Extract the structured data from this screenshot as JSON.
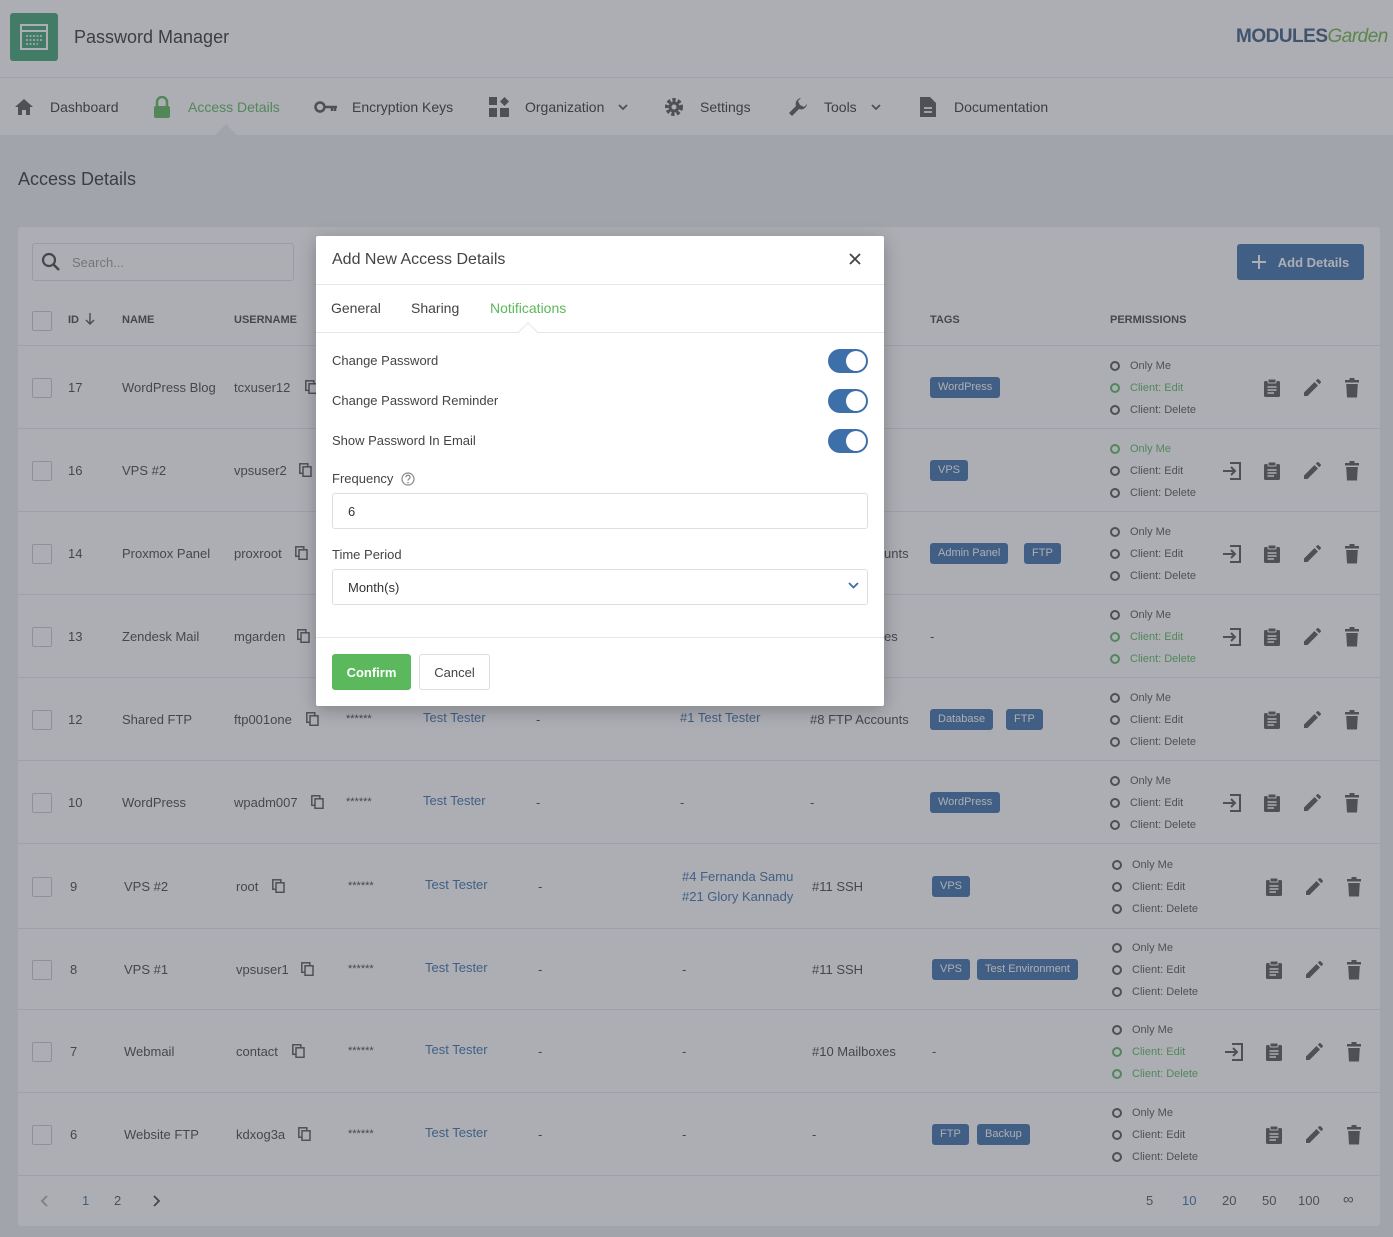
{
  "app": {
    "title": "Password Manager",
    "brand_main": "MODULES",
    "brand_accent": "Garden"
  },
  "nav": [
    {
      "label": "Dashboard",
      "icon": "home-icon"
    },
    {
      "label": "Access Details",
      "icon": "lock-icon",
      "active": true
    },
    {
      "label": "Encryption Keys",
      "icon": "key-icon"
    },
    {
      "label": "Organization",
      "icon": "grid-icon",
      "dropdown": true
    },
    {
      "label": "Settings",
      "icon": "gear-icon"
    },
    {
      "label": "Tools",
      "icon": "wrench-icon",
      "dropdown": true
    },
    {
      "label": "Documentation",
      "icon": "document-icon"
    }
  ],
  "page": {
    "title": "Access Details",
    "search_placeholder": "Search...",
    "add_button": "Add Details"
  },
  "table": {
    "headers": {
      "id": "ID",
      "name": "NAME",
      "username": "USERNAME",
      "tags": "TAGS",
      "permissions": "PERMISSIONS"
    },
    "rows": [
      {
        "id": "17",
        "name": "WordPress Blog",
        "username": "tcxuser12",
        "tags": [
          "WordPress"
        ],
        "perms": [
          "Only Me",
          "Client: Edit",
          "Client: Delete"
        ],
        "perm_on": [
          false,
          true,
          false
        ],
        "login": false
      },
      {
        "id": "16",
        "name": "VPS #2",
        "username": "vpsuser2",
        "tags": [
          "VPS"
        ],
        "perms": [
          "Only Me",
          "Client: Edit",
          "Client: Delete"
        ],
        "perm_on": [
          true,
          false,
          false
        ],
        "login": true
      },
      {
        "id": "14",
        "name": "Proxmox Panel",
        "username": "proxroot",
        "group_tail": "unts",
        "tags": [
          "Admin Panel",
          "FTP"
        ],
        "perms": [
          "Only Me",
          "Client: Edit",
          "Client: Delete"
        ],
        "perm_on": [
          false,
          false,
          false
        ],
        "login": true
      },
      {
        "id": "13",
        "name": "Zendesk Mail",
        "username": "mgarden",
        "group_tail": "es",
        "tags_text": "-",
        "perms": [
          "Only Me",
          "Client: Edit",
          "Client: Delete"
        ],
        "perm_on": [
          false,
          true,
          true
        ],
        "login": true
      },
      {
        "id": "12",
        "name": "Shared FTP",
        "username": "ftp001one",
        "password": "******",
        "owner": "Test Tester",
        "col6": "-",
        "shared": [
          "#1 Test Tester"
        ],
        "group": "#8 FTP Accounts",
        "tags": [
          "Database",
          "FTP"
        ],
        "perms": [
          "Only Me",
          "Client: Edit",
          "Client: Delete"
        ],
        "perm_on": [
          false,
          false,
          false
        ],
        "login": false
      },
      {
        "id": "10",
        "name": "WordPress",
        "username": "wpadm007",
        "password": "******",
        "owner": "Test Tester",
        "col6": "-",
        "shared_text": "-",
        "group": "-",
        "tags": [
          "WordPress"
        ],
        "perms": [
          "Only Me",
          "Client: Edit",
          "Client: Delete"
        ],
        "perm_on": [
          false,
          false,
          false
        ],
        "login": true
      },
      {
        "id": "9",
        "name": "VPS #2",
        "username": "root",
        "password": "******",
        "owner": "Test Tester",
        "col6": "-",
        "shared": [
          "#4 Fernanda Samu",
          "#21 Glory Kannady"
        ],
        "group": "#11 SSH",
        "tags": [
          "VPS"
        ],
        "perms": [
          "Only Me",
          "Client: Edit",
          "Client: Delete"
        ],
        "perm_on": [
          false,
          false,
          false
        ],
        "login": false
      },
      {
        "id": "8",
        "name": "VPS #1",
        "username": "vpsuser1",
        "password": "******",
        "owner": "Test Tester",
        "col6": "-",
        "shared_text": "-",
        "group": "#11 SSH",
        "tags": [
          "VPS",
          "Test Environment"
        ],
        "perms": [
          "Only Me",
          "Client: Edit",
          "Client: Delete"
        ],
        "perm_on": [
          false,
          false,
          false
        ],
        "login": false
      },
      {
        "id": "7",
        "name": "Webmail",
        "username": "contact",
        "password": "******",
        "owner": "Test Tester",
        "col6": "-",
        "shared_text": "-",
        "group": "#10 Mailboxes",
        "tags_text": "-",
        "perms": [
          "Only Me",
          "Client: Edit",
          "Client: Delete"
        ],
        "perm_on": [
          false,
          true,
          true
        ],
        "login": true
      },
      {
        "id": "6",
        "name": "Website FTP",
        "username": "kdxog3a",
        "password": "******",
        "owner": "Test Tester",
        "col6": "-",
        "shared_text": "-",
        "group": "-",
        "tags": [
          "FTP",
          "Backup"
        ],
        "perms": [
          "Only Me",
          "Client: Edit",
          "Client: Delete"
        ],
        "perm_on": [
          false,
          false,
          false
        ],
        "login": false
      }
    ]
  },
  "pagination": {
    "pages": [
      "1",
      "2"
    ],
    "sizes": [
      "5",
      "10",
      "20",
      "50",
      "100",
      "∞"
    ],
    "current_size": "10"
  },
  "modal": {
    "title": "Add New Access Details",
    "tabs": [
      "General",
      "Sharing",
      "Notifications"
    ],
    "active_tab": "Notifications",
    "toggles": [
      {
        "label": "Change Password",
        "on": true
      },
      {
        "label": "Change Password Reminder",
        "on": true
      },
      {
        "label": "Show Password In Email",
        "on": true
      }
    ],
    "frequency_label": "Frequency",
    "frequency_value": "6",
    "period_label": "Time Period",
    "period_value": "Month(s)",
    "confirm": "Confirm",
    "cancel": "Cancel"
  },
  "colors": {
    "accent_green": "#5cb85c",
    "primary_blue": "#3d6fa8",
    "logo_green": "#3ea372"
  }
}
